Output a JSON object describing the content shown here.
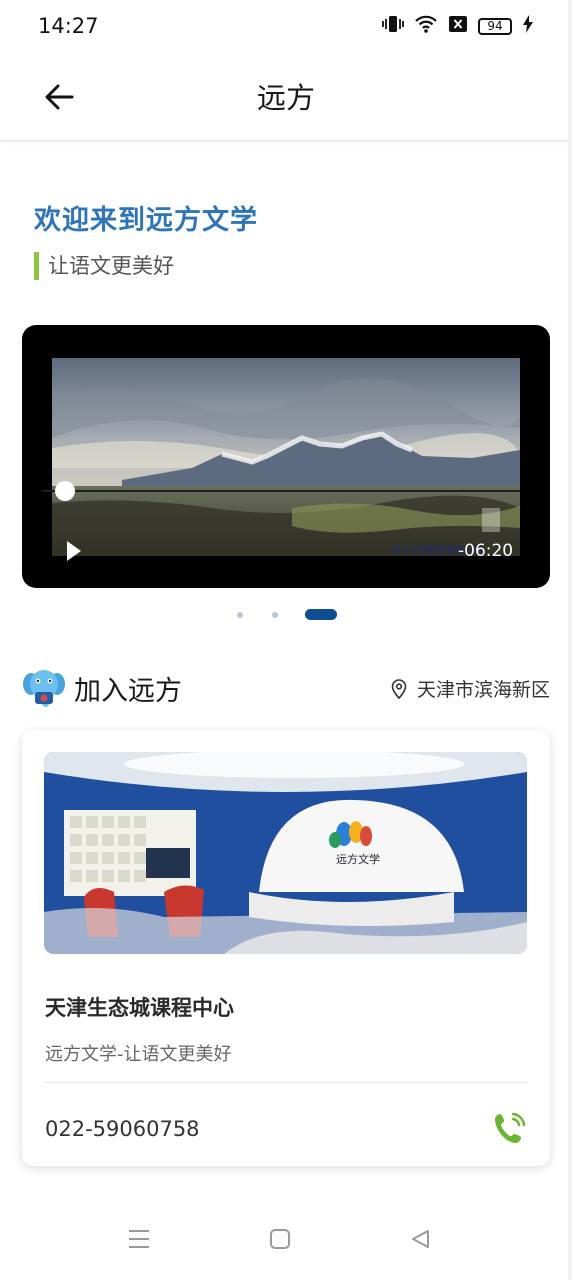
{
  "status_bar": {
    "time": "14:27",
    "battery": "94",
    "icons": [
      "vibrate-icon",
      "wifi-icon",
      "no-sim-icon",
      "battery-icon",
      "charging-icon"
    ]
  },
  "header": {
    "title": "远方",
    "back_icon": "arrow-left-icon"
  },
  "welcome": {
    "title": "欢迎来到远方文学",
    "slogan": "让语文更美好",
    "title_color": "#2d74b9",
    "accent_color": "#8cc63f"
  },
  "video": {
    "remaining_time": "-06:20",
    "progress": 0.02,
    "play_icon": "play-icon",
    "caption": "远方文学教育有限公司"
  },
  "carousel": {
    "count": 3,
    "active_index": 2,
    "active_color": "#0e4d92"
  },
  "join": {
    "title": "加入远方",
    "location": "天津市滨海新区",
    "mascot_icon": "elephant-mascot-icon",
    "location_icon": "location-pin-icon"
  },
  "center_card": {
    "image_brand": "远方文学",
    "name": "天津生态城课程中心",
    "subtitle": "远方文学-让语文更美好",
    "phone": "022-59060758",
    "phone_icon": "phone-call-icon",
    "phone_icon_color": "#6ab531"
  },
  "nav_bar": {
    "items": [
      "menu-icon",
      "home-icon",
      "back-icon"
    ]
  }
}
